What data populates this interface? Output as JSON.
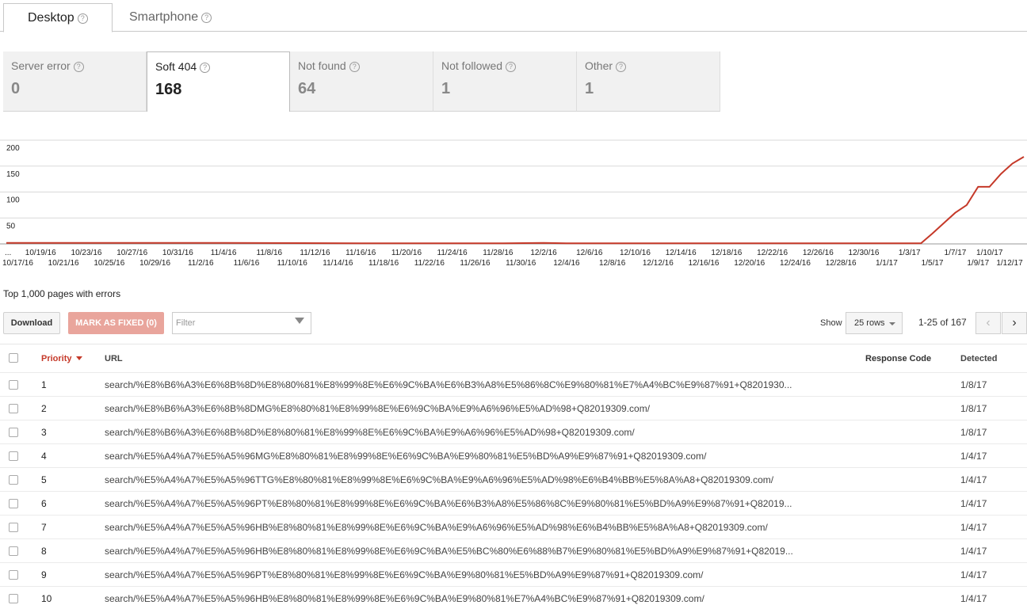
{
  "device_tabs": [
    {
      "label": "Desktop",
      "active": true
    },
    {
      "label": "Smartphone",
      "active": false
    }
  ],
  "help_glyph": "?",
  "categories": [
    {
      "label": "Server error",
      "value": "0",
      "active": false
    },
    {
      "label": "Soft 404",
      "value": "168",
      "active": true
    },
    {
      "label": "Not found",
      "value": "64",
      "active": false
    },
    {
      "label": "Not followed",
      "value": "1",
      "active": false
    },
    {
      "label": "Other",
      "value": "1",
      "active": false
    }
  ],
  "chart_data": {
    "type": "line",
    "color": "#c53929",
    "ylim": [
      0,
      200
    ],
    "yticks": [
      "200",
      "150",
      "100",
      "50"
    ],
    "x_start_label": "...",
    "x_labels_top": [
      "10/19/16",
      "10/23/16",
      "10/27/16",
      "10/31/16",
      "11/4/16",
      "11/8/16",
      "11/12/16",
      "11/16/16",
      "11/20/16",
      "11/24/16",
      "11/28/16",
      "12/2/16",
      "12/6/16",
      "12/10/16",
      "12/14/16",
      "12/18/16",
      "12/22/16",
      "12/26/16",
      "12/30/16",
      "1/3/17",
      "1/7/17",
      "1/10/17"
    ],
    "x_labels_bottom": [
      "10/17/16",
      "10/21/16",
      "10/25/16",
      "10/29/16",
      "11/2/16",
      "11/6/16",
      "11/10/16",
      "11/14/16",
      "11/18/16",
      "11/22/16",
      "11/26/16",
      "11/30/16",
      "12/4/16",
      "12/8/16",
      "12/12/16",
      "12/16/16",
      "12/20/16",
      "12/24/16",
      "12/28/16",
      "1/1/17",
      "1/5/17",
      "1/9/17",
      "1/12/17"
    ],
    "series": [
      {
        "x": [
          "10/16/16",
          "11/4/16",
          "11/16/16",
          "11/28/16",
          "12/2/16",
          "12/4/16",
          "12/20/16",
          "12/30/16",
          "1/3/17",
          "1/4/17",
          "1/5/17",
          "1/6/17",
          "1/7/17",
          "1/8/17",
          "1/9/17",
          "1/10/17",
          "1/11/17",
          "1/12/17",
          "1/13/17"
        ],
        "values": [
          2,
          2,
          1,
          1,
          2,
          1,
          1,
          1,
          1,
          1,
          20,
          40,
          60,
          75,
          110,
          110,
          135,
          155,
          168
        ]
      }
    ]
  },
  "summary": "Top 1,000 pages with errors",
  "toolbar": {
    "download": "Download",
    "mark_fixed": "MARK AS FIXED (0)",
    "filter_placeholder": "Filter",
    "show_label": "Show",
    "rows_value": "25 rows",
    "range": "1-25 of 167",
    "prev": "‹",
    "next": "›"
  },
  "table": {
    "headers": {
      "priority": "Priority",
      "url": "URL",
      "response": "Response Code",
      "detected": "Detected"
    },
    "rows": [
      {
        "priority": "1",
        "url": "search/%E8%B6%A3%E6%8B%8D%E8%80%81%E8%99%8E%E6%9C%BA%E6%B3%A8%E5%86%8C%E9%80%81%E7%A4%BC%E9%87%91+Q8201930...",
        "response": "",
        "detected": "1/8/17"
      },
      {
        "priority": "2",
        "url": "search/%E8%B6%A3%E6%8B%8DMG%E8%80%81%E8%99%8E%E6%9C%BA%E9%A6%96%E5%AD%98+Q82019309.com/",
        "response": "",
        "detected": "1/8/17"
      },
      {
        "priority": "3",
        "url": "search/%E8%B6%A3%E6%8B%8D%E8%80%81%E8%99%8E%E6%9C%BA%E9%A6%96%E5%AD%98+Q82019309.com/",
        "response": "",
        "detected": "1/8/17"
      },
      {
        "priority": "4",
        "url": "search/%E5%A4%A7%E5%A5%96MG%E8%80%81%E8%99%8E%E6%9C%BA%E9%80%81%E5%BD%A9%E9%87%91+Q82019309.com/",
        "response": "",
        "detected": "1/4/17"
      },
      {
        "priority": "5",
        "url": "search/%E5%A4%A7%E5%A5%96TTG%E8%80%81%E8%99%8E%E6%9C%BA%E9%A6%96%E5%AD%98%E6%B4%BB%E5%8A%A8+Q82019309.com/",
        "response": "",
        "detected": "1/4/17"
      },
      {
        "priority": "6",
        "url": "search/%E5%A4%A7%E5%A5%96PT%E8%80%81%E8%99%8E%E6%9C%BA%E6%B3%A8%E5%86%8C%E9%80%81%E5%BD%A9%E9%87%91+Q82019...",
        "response": "",
        "detected": "1/4/17"
      },
      {
        "priority": "7",
        "url": "search/%E5%A4%A7%E5%A5%96HB%E8%80%81%E8%99%8E%E6%9C%BA%E9%A6%96%E5%AD%98%E6%B4%BB%E5%8A%A8+Q82019309.com/",
        "response": "",
        "detected": "1/4/17"
      },
      {
        "priority": "8",
        "url": "search/%E5%A4%A7%E5%A5%96HB%E8%80%81%E8%99%8E%E6%9C%BA%E5%BC%80%E6%88%B7%E9%80%81%E5%BD%A9%E9%87%91+Q82019...",
        "response": "",
        "detected": "1/4/17"
      },
      {
        "priority": "9",
        "url": "search/%E5%A4%A7%E5%A5%96PT%E8%80%81%E8%99%8E%E6%9C%BA%E9%80%81%E5%BD%A9%E9%87%91+Q82019309.com/",
        "response": "",
        "detected": "1/4/17"
      },
      {
        "priority": "10",
        "url": "search/%E5%A4%A7%E5%A5%96HB%E8%80%81%E8%99%8E%E6%9C%BA%E9%80%81%E7%A4%BC%E9%87%91+Q82019309.com/",
        "response": "",
        "detected": "1/4/17"
      }
    ]
  }
}
